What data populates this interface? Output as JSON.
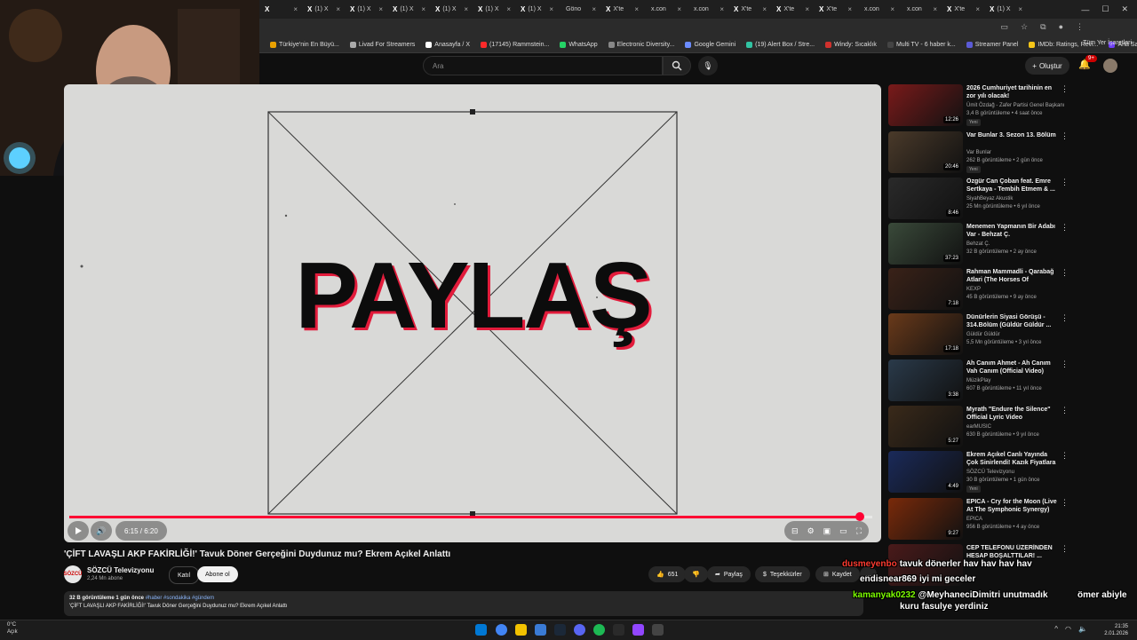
{
  "browser": {
    "tabs": [
      {
        "fav": "X",
        "label": ""
      },
      {
        "fav": "X",
        "label": "(1) X"
      },
      {
        "fav": "X",
        "label": "(1) X"
      },
      {
        "fav": "X",
        "label": "(1) X"
      },
      {
        "fav": "X",
        "label": "(1) X"
      },
      {
        "fav": "X",
        "label": "(1) X"
      },
      {
        "fav": "X",
        "label": "(1) X"
      },
      {
        "fav": "",
        "label": "Göno"
      },
      {
        "fav": "X",
        "label": "X'te"
      },
      {
        "fav": "",
        "label": "x.con"
      },
      {
        "fav": "",
        "label": "x.con"
      },
      {
        "fav": "X",
        "label": "X'te"
      },
      {
        "fav": "X",
        "label": "X'te"
      },
      {
        "fav": "X",
        "label": "X'te"
      },
      {
        "fav": "",
        "label": "x.con"
      },
      {
        "fav": "",
        "label": "x.con"
      },
      {
        "fav": "X",
        "label": "X'te"
      },
      {
        "fav": "X",
        "label": "(1) X"
      }
    ],
    "bookmarks": [
      {
        "label": "Türkiye'nin En Büyü...",
        "color": "#e8a000"
      },
      {
        "label": "Livad For Streamers",
        "color": "#aaaaaa"
      },
      {
        "label": "Anasayfa / X",
        "color": "#ffffff"
      },
      {
        "label": "(17145) Rammstein...",
        "color": "#ff2a2a"
      },
      {
        "label": "WhatsApp",
        "color": "#25d366"
      },
      {
        "label": "Electronic Diversity...",
        "color": "#888888"
      },
      {
        "label": "Google Gemini",
        "color": "#6b8cff"
      },
      {
        "label": "(19) Alert Box / Stre...",
        "color": "#31c3a2"
      },
      {
        "label": "Windy: Sıcaklık",
        "color": "#d0312d"
      },
      {
        "label": "Multi TV - 6 haber k...",
        "color": "#444444"
      },
      {
        "label": "Streamer Panel",
        "color": "#5b5bd6"
      },
      {
        "label": "IMDb: Ratings, Revi...",
        "color": "#f5c518"
      },
      {
        "label": "Ana Sayfa • HBO Max",
        "color": "#6e3df5"
      }
    ],
    "all_bookmarks": "Tüm Yer İşaretleri"
  },
  "youtube": {
    "search_placeholder": "Ara",
    "create_label": "Oluştur",
    "notification_count": "9+"
  },
  "player": {
    "overlay_text": "PAYLAŞ",
    "time_display": "6:15 / 6:20",
    "progress_fraction": 0.984
  },
  "video": {
    "title": "'ÇİFT LAVAŞLI AKP FAKİRLİĞİ!' Tavuk Döner Gerçeğini Duydunuz mu? Ekrem Açıkel Anlattı",
    "channel_name": "SÖZCÜ Televizyonu",
    "channel_avatar_text": "SÖZCÜ",
    "subscribers": "2,24 Mn abone",
    "join_label": "Katıl",
    "subscribe_label": "Abone ol",
    "likes": "651",
    "share_label": "Paylaş",
    "thanks_label": "Teşekkürler",
    "save_label": "Kaydet",
    "desc_stats": "32 B görüntüleme  1 gün önce",
    "desc_tags": "#haber #sondakika #gündem",
    "desc_text": "'ÇİFT LAVAŞLI AKP FAKİRLİĞİ!' Tavuk Döner Gerçeğini Duydunuz mu? Ekrem Açıkel Anlattı"
  },
  "recommendations": [
    {
      "title": "2026 Cumhuriyet tarihinin en zor yılı olacak!",
      "channel": "Ümit Özdağ - Zafer Partisi Genel Başkanı",
      "meta": "3,4 B görüntüleme • 4 saat önce",
      "duration": "12:26",
      "badge": "Yeni",
      "color": "#7a1a1a"
    },
    {
      "title": "Var Bunlar 3. Sezon 13. Bölüm",
      "channel": "Var Bunlar",
      "meta": "262 B görüntüleme • 2 gün önce",
      "duration": "20:46",
      "badge": "Yeni",
      "color": "#4a3a2a"
    },
    {
      "title": "Özgür Can Çoban feat. Emre Sertkaya - Tembih Etmem & ...",
      "channel": "SiyahBeyaz Akustik",
      "meta": "25 Mn görüntüleme • 6 yıl önce",
      "duration": "8:46",
      "badge": "",
      "color": "#2a2a2a"
    },
    {
      "title": "Menemen Yapmanın Bir Adabı Var - Behzat Ç.",
      "channel": "Behzat Ç.",
      "meta": "32 B görüntüleme • 2 ay önce",
      "duration": "37:23",
      "badge": "",
      "color": "#3a4a3a"
    },
    {
      "title": "Rahman Mammadli - Qarabağ Atlari (The Horses Of Karabak...",
      "channel": "KEXP",
      "meta": "45 B görüntüleme • 9 ay önce",
      "duration": "7:18",
      "badge": "",
      "color": "#3a2218"
    },
    {
      "title": "Dünürlerin Siyasi Görüşü - 314.Bölüm (Güldür Güldür ...",
      "channel": "Güldür Güldür",
      "meta": "5,5 Mn görüntüleme • 3 yıl önce",
      "duration": "17:18",
      "badge": "",
      "color": "#6a3a1a"
    },
    {
      "title": "Ah Canım Ahmet - Ah Canım Vah Canım (Official Video)",
      "channel": "MüzikPlay",
      "meta": "607 B görüntüleme • 11 yıl önce",
      "duration": "3:38",
      "badge": "",
      "color": "#2a3a4a"
    },
    {
      "title": "Myrath \"Endure the Silence\" Official Lyric Video",
      "channel": "earMUSIC",
      "meta": "630 B görüntüleme • 9 yıl önce",
      "duration": "5:27",
      "badge": "",
      "color": "#3a2a1a"
    },
    {
      "title": "Ekrem Açıkel Canlı Yayında Çok Sinirlendi! Kazık Fiyatlara Kim ...",
      "channel": "SÖZCÜ Televizyonu",
      "meta": "30 B görüntüleme • 1 gün önce",
      "duration": "4:49",
      "badge": "Yeni",
      "color": "#1a2a5a"
    },
    {
      "title": "EPICA - Cry for the Moon (Live At The Symphonic Synergy)",
      "channel": "EPICA",
      "meta": "956 B görüntüleme • 4 ay önce",
      "duration": "9:27",
      "badge": "",
      "color": "#7a2a0a"
    },
    {
      "title": "CEP TELEFONU ÜZERİNDEN HESAP BOŞALTTILAR! ...",
      "channel": "",
      "meta": "",
      "duration": "",
      "badge": "",
      "color": "#4a1a1a"
    }
  ],
  "chat": [
    {
      "user": "dusmeyenbo",
      "message": "tavuk dönerler hav hav hav hav",
      "user_color": "#ff3b30"
    },
    {
      "user": "endisnear869",
      "message": "iyi mi geceler",
      "user_color": "#ffffff"
    },
    {
      "user": "kamanyak0232",
      "message": "@MeyhaneciDimitri unutmadık",
      "user_color": "#7cfc00"
    },
    {
      "user": "ömer abiyle",
      "message": "kuru fasulye yerdiniz",
      "user_color": "#ffffff"
    },
    {
      "user": "kamanyak0232",
      "message": "",
      "user_color": "#7cfc00"
    }
  ],
  "taskbar": {
    "weather_temp": "0°C",
    "weather_text": "Açık",
    "time": "21:35",
    "date": "2.01.2026"
  }
}
